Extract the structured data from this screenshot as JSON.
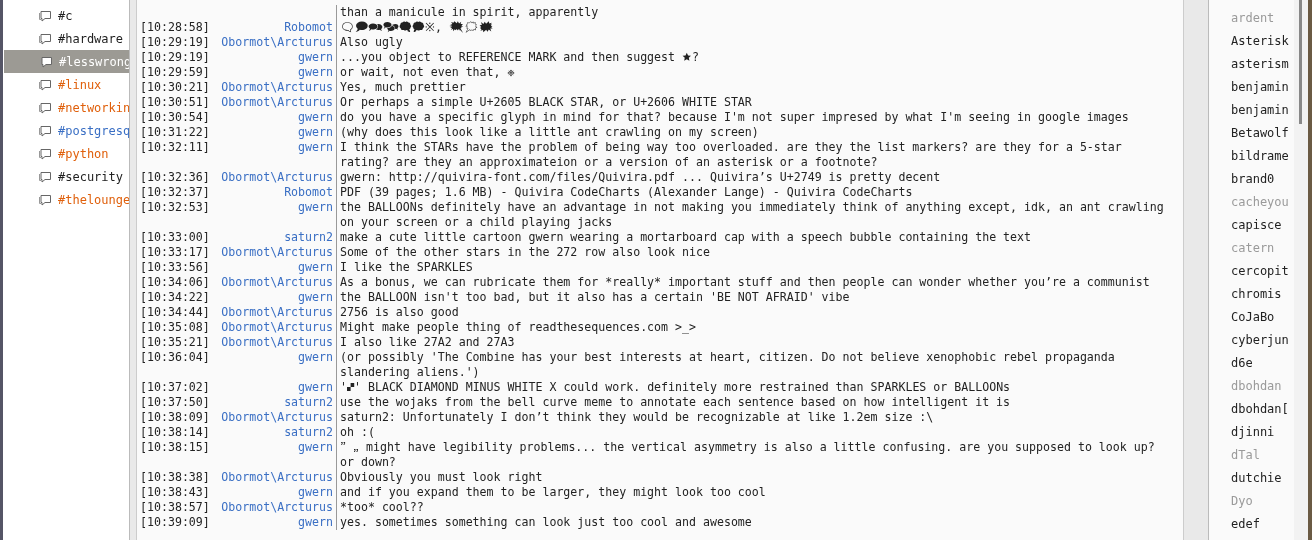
{
  "channels": [
    {
      "name": "#c",
      "color": "#222222",
      "selected": false
    },
    {
      "name": "#hardware",
      "color": "#222222",
      "selected": false
    },
    {
      "name": "#lesswrong",
      "color": "#ffffff",
      "selected": true
    },
    {
      "name": "#linux",
      "color": "#e0600c",
      "selected": false
    },
    {
      "name": "#networkin",
      "color": "#e0600c",
      "selected": false
    },
    {
      "name": "#postgresq",
      "color": "#3a6fc4",
      "selected": false
    },
    {
      "name": "#python",
      "color": "#e0600c",
      "selected": false
    },
    {
      "name": "#security",
      "color": "#222222",
      "selected": false
    },
    {
      "name": "#thelounge",
      "color": "#e0600c",
      "selected": false
    }
  ],
  "messages": [
    {
      "text": "than a manicule in spirit, apparently"
    },
    {
      "time": "[10:28:58]",
      "nick": "Robomot",
      "text": "🗨🗩🗪🗫🗬🗭※, 🗮🗯🗰"
    },
    {
      "time": "[10:29:19]",
      "nick": "Obormot\\Arcturus",
      "text": "Also ugly"
    },
    {
      "time": "[10:29:19]",
      "nick": "gwern",
      "text": "...you object to REFERENCE MARK and then suggest 🟊?"
    },
    {
      "time": "[10:29:59]",
      "nick": "gwern",
      "text": "or wait, not even that, ❉"
    },
    {
      "time": "[10:30:21]",
      "nick": "Obormot\\Arcturus",
      "text": "Yes, much prettier"
    },
    {
      "time": "[10:30:51]",
      "nick": "Obormot\\Arcturus",
      "text": "Or perhaps a simple U+2605 BLACK STAR, or U+2606 WHITE STAR"
    },
    {
      "time": "[10:30:54]",
      "nick": "gwern",
      "text": "do you have a specific glyph in mind for that? because I'm not super impresed by what I'm seeing in google images"
    },
    {
      "time": "[10:31:22]",
      "nick": "gwern",
      "text": "(why does this look like a little ant crawling on my screen)"
    },
    {
      "time": "[10:32:11]",
      "nick": "gwern",
      "text": "I think the STARs have the problem of being way too overloaded. are they the list markers? are they for a 5-star rating? are they an approximateion or a version of an asterisk or a footnote?"
    },
    {
      "time": "[10:32:36]",
      "nick": "Obormot\\Arcturus",
      "text": "gwern: http://quivira-font.com/files/Quivira.pdf ... Quivira’s U+2749 is pretty decent"
    },
    {
      "time": "[10:32:37]",
      "nick": "Robomot",
      "text": "PDF (39 pages; 1.6 MB) - Quivira CodeCharts (Alexander Lange) - Quivira CodeCharts"
    },
    {
      "time": "[10:32:53]",
      "nick": "gwern",
      "text": "the BALLOONs definitely have an advantage in not making you immediately think of anything except, idk, an ant crawling on your screen or a child playing jacks"
    },
    {
      "time": "[10:33:00]",
      "nick": "saturn2",
      "text": "make a cute little cartoon gwern wearing a mortarboard cap with a speech bubble containing the text"
    },
    {
      "time": "[10:33:17]",
      "nick": "Obormot\\Arcturus",
      "text": "Some of the other stars in the 272 row also look nice"
    },
    {
      "time": "[10:33:56]",
      "nick": "gwern",
      "text": "I like the SPARKLES"
    },
    {
      "time": "[10:34:06]",
      "nick": "Obormot\\Arcturus",
      "text": "As a bonus, we can rubricate them for *really* important stuff and then people can wonder whether you’re a communist"
    },
    {
      "time": "[10:34:22]",
      "nick": "gwern",
      "text": "the BALLOON isn't too bad, but it also has a certain 'BE NOT AFRAID' vibe"
    },
    {
      "time": "[10:34:44]",
      "nick": "Obormot\\Arcturus",
      "text": "2756 is also good"
    },
    {
      "time": "[10:35:08]",
      "nick": "Obormot\\Arcturus",
      "text": "Might make people thing of readthesequences.com >_>"
    },
    {
      "time": "[10:35:21]",
      "nick": "Obormot\\Arcturus",
      "text": "I also like 27A2 and 27A3"
    },
    {
      "time": "[10:36:04]",
      "nick": "gwern",
      "text": "(or possibly 'The Combine has your best interests at heart, citizen. Do not believe xenophobic rebel propaganda slandering aliens.')"
    },
    {
      "time": "[10:37:02]",
      "nick": "gwern",
      "text": "'🙾' BLACK DIAMOND MINUS WHITE X could work. definitely more restrained than SPARKLES or BALLOONs"
    },
    {
      "time": "[10:37:50]",
      "nick": "saturn2",
      "text": "use the wojaks from the bell curve meme to annotate each sentence based on how intelligent it is"
    },
    {
      "time": "[10:38:09]",
      "nick": "Obormot\\Arcturus",
      "text": "saturn2: Unfortunately I don’t think they would be recognizable at like 1.2em size :\\"
    },
    {
      "time": "[10:38:14]",
      "nick": "saturn2",
      "text": "oh :("
    },
    {
      "time": "[10:38:15]",
      "nick": "gwern",
      "text": "🙷 🙸 might have legibility problems... the vertical asymmetry is also a little confusing. are you supposed to look up? or down?"
    },
    {
      "time": "[10:38:38]",
      "nick": "Obormot\\Arcturus",
      "text": "Obviously you must look right"
    },
    {
      "time": "[10:38:43]",
      "nick": "gwern",
      "text": "and if you expand them to be larger, they might look too cool"
    },
    {
      "time": "[10:38:57]",
      "nick": "Obormot\\Arcturus",
      "text": "*too* cool??"
    },
    {
      "time": "[10:39:09]",
      "nick": "gwern",
      "text": "yes. sometimes something can look just too cool and awesome"
    }
  ],
  "users": [
    {
      "name": "ardent",
      "away": true
    },
    {
      "name": "Asterisk",
      "away": false
    },
    {
      "name": "asterism",
      "away": false
    },
    {
      "name": "benjamin",
      "away": false
    },
    {
      "name": "benjamin",
      "away": false
    },
    {
      "name": "Betawolf",
      "away": false
    },
    {
      "name": "bildrame",
      "away": false
    },
    {
      "name": "brand0",
      "away": false
    },
    {
      "name": "cacheyou",
      "away": true
    },
    {
      "name": "capisce",
      "away": false
    },
    {
      "name": "catern",
      "away": true
    },
    {
      "name": "cercopit",
      "away": false
    },
    {
      "name": "chromis",
      "away": false
    },
    {
      "name": "CoJaBo",
      "away": false
    },
    {
      "name": "cyberjun",
      "away": false
    },
    {
      "name": "d6e",
      "away": false
    },
    {
      "name": "dbohdan",
      "away": true
    },
    {
      "name": "dbohdan[",
      "away": false
    },
    {
      "name": "djinni",
      "away": false
    },
    {
      "name": "dTal",
      "away": true
    },
    {
      "name": "dutchie",
      "away": false
    },
    {
      "name": "Dyo",
      "away": true
    },
    {
      "name": "edef",
      "away": false
    }
  ]
}
